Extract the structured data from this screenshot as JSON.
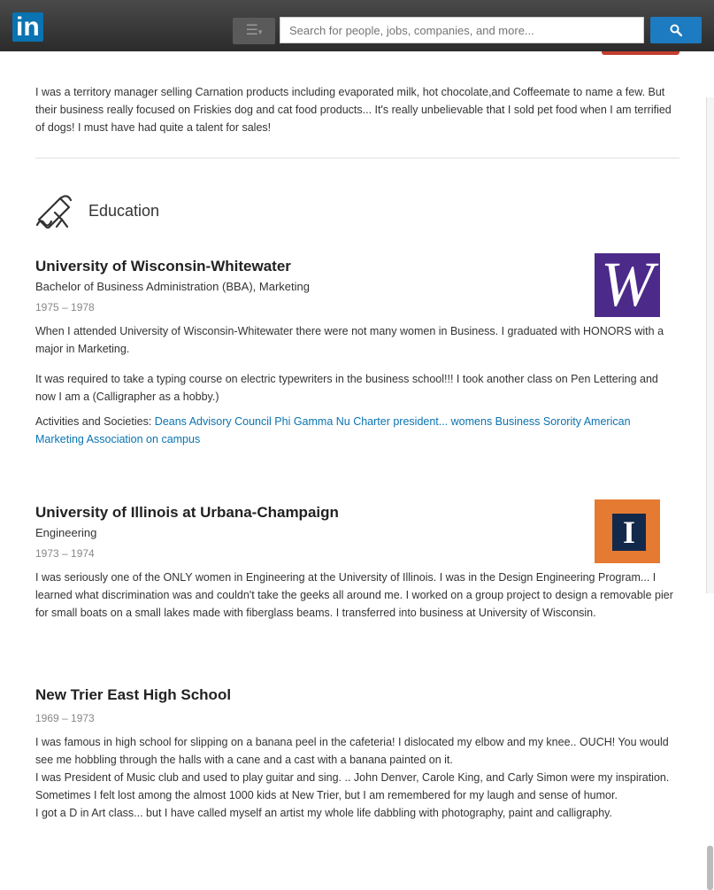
{
  "topbar": {
    "logo_text": "in",
    "menu_icon": "list-icon",
    "search_placeholder": "Search for people, jobs, companies, and more...",
    "search_icon": "search-icon"
  },
  "experience": {
    "description": "I was a territory manager selling Carnation products including evaporated milk, hot chocolate,and Coffeemate to name a few. But their business really focused on Friskies dog and cat food products... It's really unbelievable that I sold pet food when I am terrified of dogs! I must have had quite a talent for sales!"
  },
  "education": {
    "heading": "Education",
    "icon": "diploma-icon",
    "schools": [
      {
        "name": "University of Wisconsin-Whitewater",
        "degree": "Bachelor of Business Administration (BBA), Marketing",
        "dates": "1975 – 1978",
        "description": "When I attended University of Wisconsin-Whitewater there were not many women in Business. I graduated with HONORS with a major in Marketing.",
        "description2": "It was required to take a typing course on electric typewriters in the business school!!! I took another class on Pen Lettering and now I am a (Calligrapher as a hobby.)",
        "activities_label": "Activities and Societies: ",
        "activities": "Deans Advisory Council Phi Gamma Nu Charter president... womens Business Sorority American Marketing Association on campus",
        "logo_letter": "W"
      },
      {
        "name": "University of Illinois at Urbana-Champaign",
        "degree": "Engineering",
        "dates": "1973 – 1974",
        "description": "I was seriously one of the ONLY women in Engineering at the University of Illinois. I was in the Design Engineering Program... I learned what discrimination was and couldn't take the geeks all around me. I worked on a group project to design a removable pier for small boats on a small lakes made with fiberglass beams. I transferred into business at University of Wisconsin.",
        "logo_letter": "I"
      },
      {
        "name": "New Trier East High School",
        "dates": "1969 – 1973",
        "lines": [
          "I was famous in high school for slipping on a banana peel in the cafeteria! I dislocated my elbow and my knee.. OUCH! You would see me hobbling through the halls with a cane and a cast with a banana painted on it.",
          "I was President of Music club and used to play guitar and sing. .. John Denver, Carole King, and Carly Simon were my inspiration.",
          "Sometimes I felt lost among the almost 1000 kids at New Trier, but I am remembered for my laugh and sense of humor.",
          "I got a D in Art class... but I have called myself an artist my whole life dabbling with photography, paint and calligraphy."
        ]
      }
    ]
  },
  "colors": {
    "link": "#0a73b1",
    "brand": "#0a73b1",
    "uww_purple": "#4b2a8a",
    "uiuc_orange": "#e57a32",
    "uiuc_navy": "#13294b"
  }
}
